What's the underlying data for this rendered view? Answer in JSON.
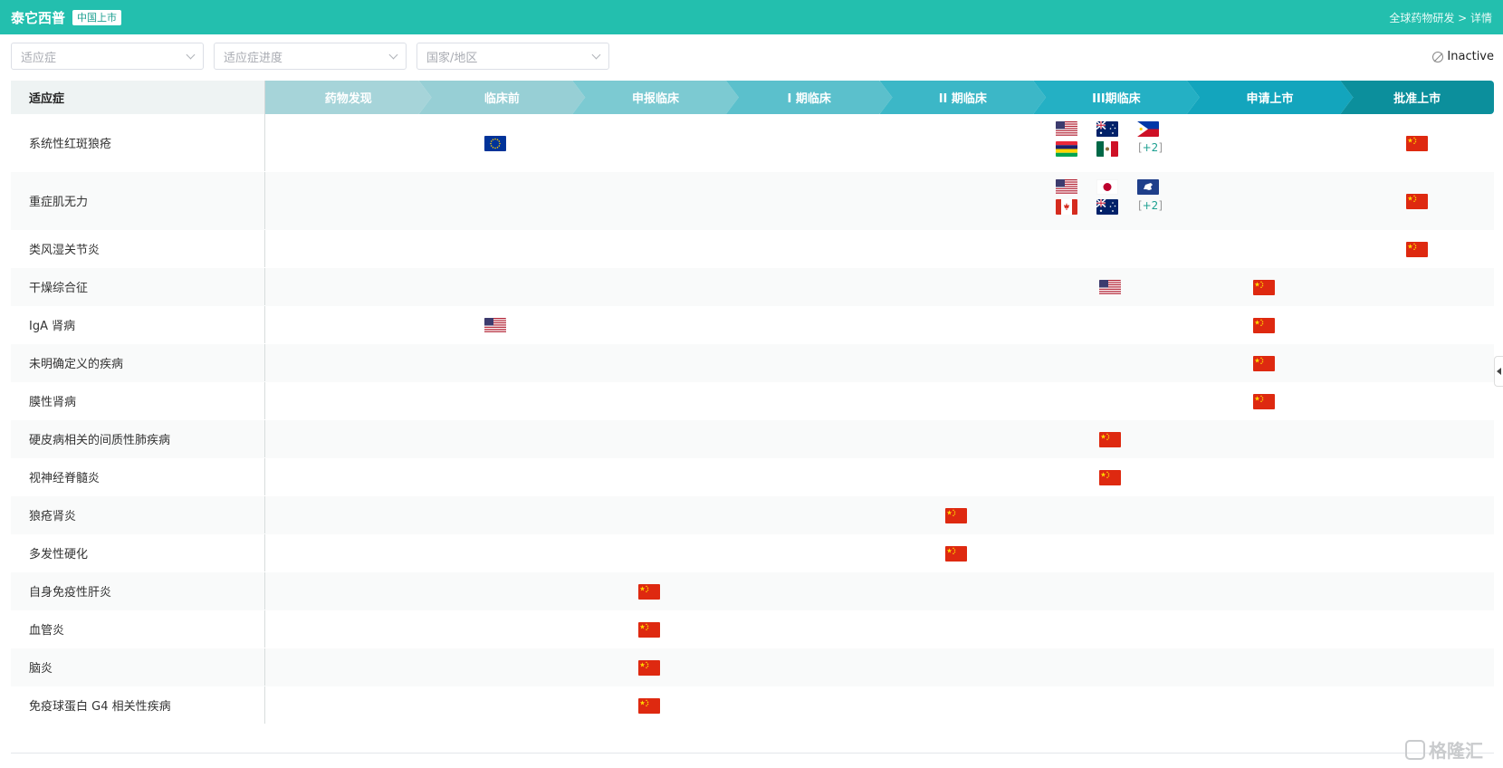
{
  "header": {
    "drug_name": "泰它西普",
    "status_tag": "中国上市",
    "detail_link": "全球药物研发 > 详情"
  },
  "filters": {
    "indication_placeholder": "适应症",
    "progress_placeholder": "适应症进度",
    "region_placeholder": "国家/地区"
  },
  "inactive_label": "Inactive",
  "table": {
    "indication_header": "适应症",
    "stages": [
      "药物发现",
      "临床前",
      "申报临床",
      "I 期临床",
      "II 期临床",
      "III期临床",
      "申请上市",
      "批准上市"
    ],
    "stage_colors": [
      "#a6d4d9",
      "#97cfd5",
      "#7ccad2",
      "#5bc0cc",
      "#3cb7c7",
      "#24b0c4",
      "#13a5bd",
      "#0c8f9c"
    ],
    "rows": [
      {
        "name": "系统性红斑狼疮",
        "entries": [
          {
            "stage": 1,
            "flags": [
              "eu"
            ]
          },
          {
            "stage": 5,
            "flags": [
              "us",
              "au",
              "ph",
              "mu",
              "mx"
            ],
            "more": "+2"
          },
          {
            "stage": 7,
            "flags": [
              "cn"
            ]
          }
        ]
      },
      {
        "name": "重症肌无力",
        "entries": [
          {
            "stage": 5,
            "flags": [
              "us",
              "jp",
              "eu-map",
              "ca",
              "au"
            ],
            "more": "+2"
          },
          {
            "stage": 7,
            "flags": [
              "cn"
            ]
          }
        ]
      },
      {
        "name": "类风湿关节炎",
        "entries": [
          {
            "stage": 7,
            "flags": [
              "cn"
            ]
          }
        ]
      },
      {
        "name": "干燥综合征",
        "entries": [
          {
            "stage": 5,
            "flags": [
              "us"
            ]
          },
          {
            "stage": 6,
            "flags": [
              "cn"
            ]
          }
        ]
      },
      {
        "name": "IgA 肾病",
        "entries": [
          {
            "stage": 1,
            "flags": [
              "us"
            ]
          },
          {
            "stage": 6,
            "flags": [
              "cn"
            ]
          }
        ]
      },
      {
        "name": "未明确定义的疾病",
        "entries": [
          {
            "stage": 6,
            "flags": [
              "cn"
            ]
          }
        ]
      },
      {
        "name": "膜性肾病",
        "entries": [
          {
            "stage": 6,
            "flags": [
              "cn"
            ]
          }
        ]
      },
      {
        "name": "硬皮病相关的间质性肺疾病",
        "entries": [
          {
            "stage": 5,
            "flags": [
              "cn"
            ]
          }
        ]
      },
      {
        "name": "视神经脊髓炎",
        "entries": [
          {
            "stage": 5,
            "flags": [
              "cn"
            ]
          }
        ]
      },
      {
        "name": "狼疮肾炎",
        "entries": [
          {
            "stage": 4,
            "flags": [
              "cn"
            ]
          }
        ]
      },
      {
        "name": "多发性硬化",
        "entries": [
          {
            "stage": 4,
            "flags": [
              "cn"
            ]
          }
        ]
      },
      {
        "name": "自身免疫性肝炎",
        "entries": [
          {
            "stage": 2,
            "flags": [
              "cn"
            ]
          }
        ]
      },
      {
        "name": "血管炎",
        "entries": [
          {
            "stage": 2,
            "flags": [
              "cn"
            ]
          }
        ]
      },
      {
        "name": "脑炎",
        "entries": [
          {
            "stage": 2,
            "flags": [
              "cn"
            ]
          }
        ]
      },
      {
        "name": "免疫球蛋白 G4 相关性疾病",
        "entries": [
          {
            "stage": 2,
            "flags": [
              "cn"
            ]
          }
        ]
      }
    ]
  },
  "watermark": "格隆汇"
}
